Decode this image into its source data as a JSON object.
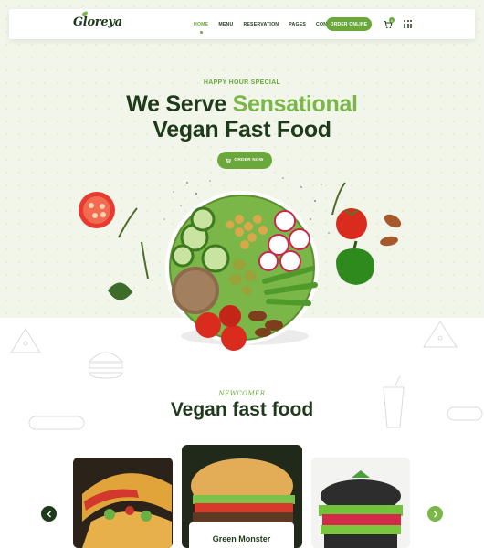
{
  "header": {
    "logo": "Gloreya",
    "nav": [
      {
        "label": "HOME",
        "active": true
      },
      {
        "label": "MENU",
        "active": false
      },
      {
        "label": "RESERVATION",
        "active": false
      },
      {
        "label": "PAGES",
        "active": false
      },
      {
        "label": "CONTACT",
        "active": false
      }
    ],
    "order_online": "ORDER ONLINE",
    "cart_count": "0",
    "icons": [
      "cart-icon",
      "grid-menu-icon"
    ],
    "accent_color": "#6aa83b"
  },
  "hero": {
    "eyebrow": "HAPPY HOUR SPECIAL",
    "headline_line1_a": "We Serve",
    "headline_line1_b": "Sensational",
    "headline_line2": "Vegan Fast Food",
    "order_now": "ORDER NOW"
  },
  "section": {
    "eyebrow": "NEWCOMER",
    "title": "Vegan fast food",
    "carousel": {
      "featured_caption": "Green Monster",
      "prev_icon": "arrow-left-icon",
      "next_icon": "arrow-right-icon"
    }
  }
}
